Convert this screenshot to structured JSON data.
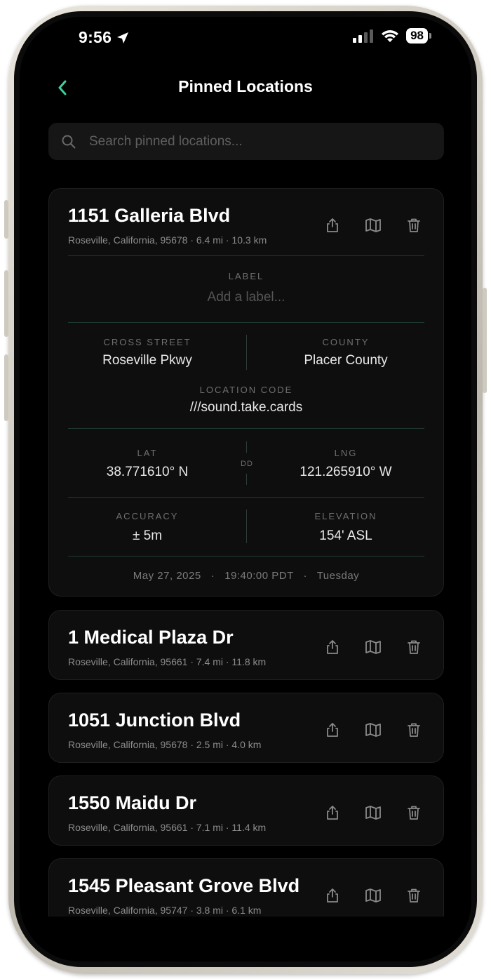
{
  "status": {
    "time": "9:56",
    "battery": "98"
  },
  "header": {
    "title": "Pinned Locations"
  },
  "search": {
    "placeholder": "Search pinned locations..."
  },
  "expanded": {
    "title": "1151 Galleria Blvd",
    "subtitle": "Roseville, California, 95678 · 6.4 mi · 10.3 km",
    "label_caption": "LABEL",
    "label_placeholder": "Add a label...",
    "cross_street_caption": "CROSS STREET",
    "cross_street": "Roseville Pkwy",
    "county_caption": "COUNTY",
    "county": "Placer County",
    "location_code_caption": "LOCATION CODE",
    "location_code": "///sound.take.cards",
    "lat_caption": "LAT",
    "lat": "38.771610° N",
    "format_caption": "DD",
    "lng_caption": "LNG",
    "lng": "121.265910° W",
    "accuracy_caption": "ACCURACY",
    "accuracy": "± 5m",
    "elevation_caption": "ELEVATION",
    "elevation": "154' ASL",
    "footer": "May 27, 2025   ·   19:40:00 PDT   ·   Tuesday"
  },
  "locations": [
    {
      "title": "1 Medical Plaza Dr",
      "subtitle": "Roseville, California, 95661 · 7.4 mi · 11.8 km"
    },
    {
      "title": "1051 Junction Blvd",
      "subtitle": "Roseville, California, 95678 · 2.5 mi · 4.0 km"
    },
    {
      "title": "1550 Maidu Dr",
      "subtitle": "Roseville, California, 95661 · 7.1 mi · 11.4 km"
    },
    {
      "title": "1545 Pleasant Grove Blvd",
      "subtitle": "Roseville, California, 95747 · 3.8 mi · 6.1 km"
    }
  ],
  "colors": {
    "accent": "#3ecf9a",
    "background": "#000000",
    "card": "#0e0e0e"
  }
}
